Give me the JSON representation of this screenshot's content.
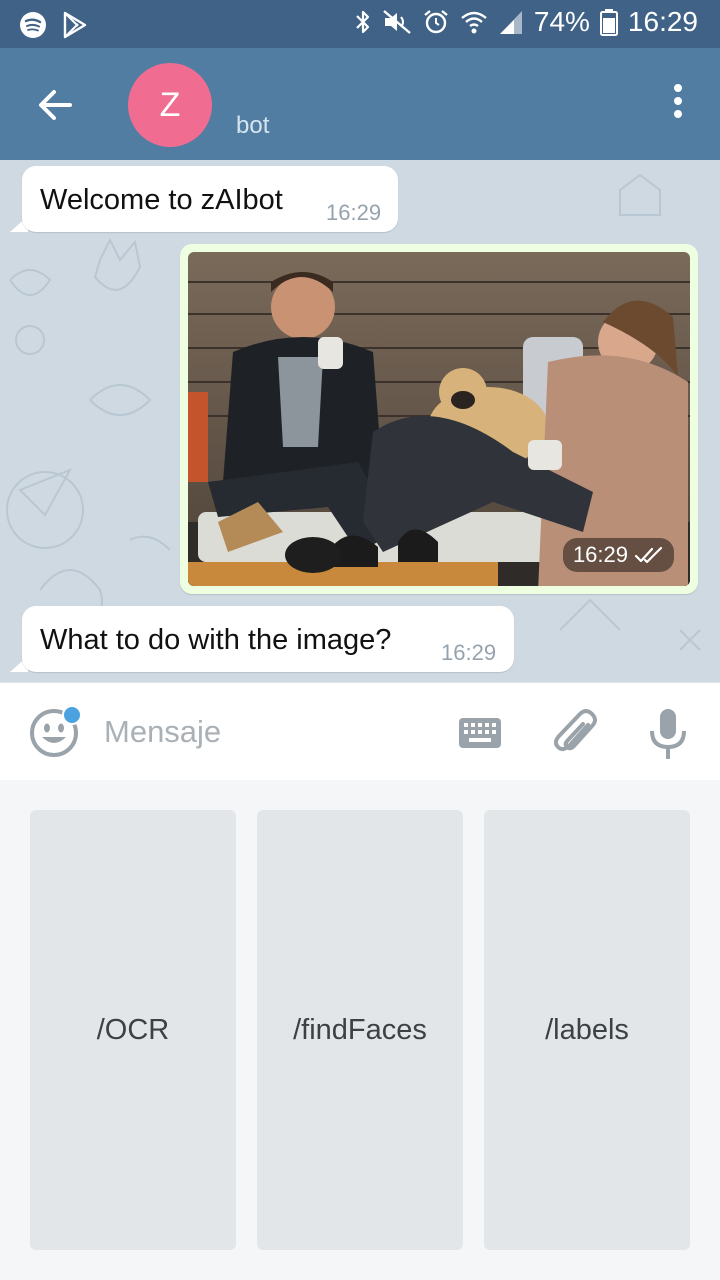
{
  "status_bar": {
    "battery": "74%",
    "time": "16:29",
    "icons": [
      "spotify-icon",
      "play-store-icon",
      "bluetooth-icon",
      "mute-icon",
      "alarm-icon",
      "wifi-icon",
      "signal-icon",
      "battery-icon"
    ]
  },
  "header": {
    "back_icon": "arrow-back-icon",
    "avatar_letter": "Z",
    "avatar_color": "#f06d91",
    "title": "",
    "subtitle": "bot",
    "menu_icon": "more-vert-icon"
  },
  "messages": [
    {
      "type": "text",
      "direction": "incoming",
      "text": "Welcome to zAIbot",
      "time": "16:29"
    },
    {
      "type": "photo",
      "direction": "outgoing",
      "time": "16:29",
      "status": "read"
    },
    {
      "type": "text",
      "direction": "incoming",
      "text": "What to do with the image?",
      "time": "16:29"
    }
  ],
  "input": {
    "placeholder": "Mensaje",
    "value": ""
  },
  "bot_keyboard": {
    "buttons": [
      "/OCR",
      "/findFaces",
      "/labels"
    ]
  },
  "colors": {
    "status_bar": "#3f6286",
    "header": "#517da2",
    "chat_background": "#cfd9e1",
    "outgoing_bubble": "#eefee0",
    "accent_dot": "#4aa3df"
  }
}
